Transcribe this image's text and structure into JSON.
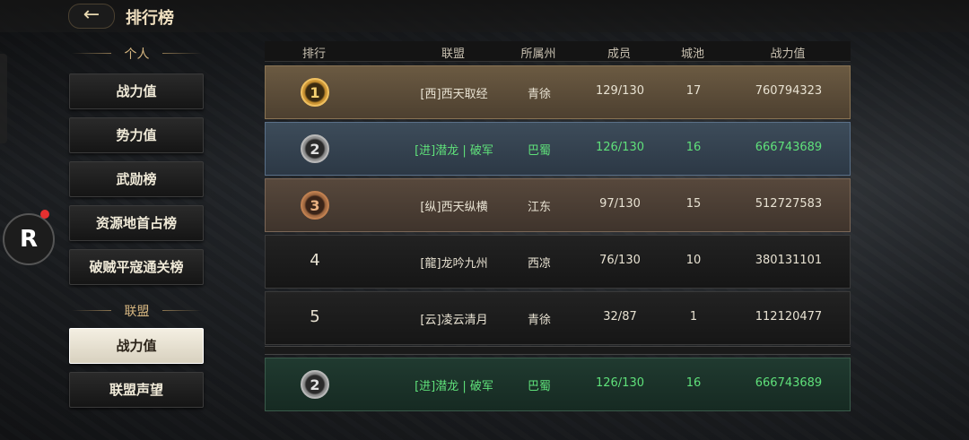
{
  "header": {
    "back_icon": "←",
    "title": "排行榜"
  },
  "sidebar": {
    "personal_label": "个人",
    "personal_items": [
      {
        "label": "战力值"
      },
      {
        "label": "势力值"
      },
      {
        "label": "武勋榜"
      },
      {
        "label": "资源地首占榜"
      },
      {
        "label": "破贼平寇通关榜"
      }
    ],
    "alliance_label": "联盟",
    "alliance_items": [
      {
        "label": "战力值",
        "active": true
      },
      {
        "label": "联盟声望"
      }
    ]
  },
  "floating": {
    "r_logo": "R"
  },
  "table": {
    "headers": {
      "rank": "排行",
      "alliance": "联盟",
      "state": "所属州",
      "members": "成员",
      "cities": "城池",
      "power": "战力值"
    },
    "rows": [
      {
        "rank": "1",
        "alliance": "[西]西天取经",
        "state": "青徐",
        "members": "129/130",
        "cities": "17",
        "power": "760794323"
      },
      {
        "rank": "2",
        "alliance": "[进]潜龙 | 破军",
        "state": "巴蜀",
        "members": "126/130",
        "cities": "16",
        "power": "666743689"
      },
      {
        "rank": "3",
        "alliance": "[纵]西天纵横",
        "state": "江东",
        "members": "97/130",
        "cities": "15",
        "power": "512727583"
      },
      {
        "rank": "4",
        "alliance": "[龍]龙吟九州",
        "state": "西凉",
        "members": "76/130",
        "cities": "10",
        "power": "380131101"
      },
      {
        "rank": "5",
        "alliance": "[云]凌云清月",
        "state": "青徐",
        "members": "32/87",
        "cities": "1",
        "power": "112120477"
      }
    ],
    "my_row": {
      "rank": "2",
      "alliance": "[进]潜龙 | 破军",
      "state": "巴蜀",
      "members": "126/130",
      "cities": "16",
      "power": "666743689"
    }
  },
  "colors": {
    "highlight": "#5fe07a",
    "gold": "#f0c060"
  }
}
